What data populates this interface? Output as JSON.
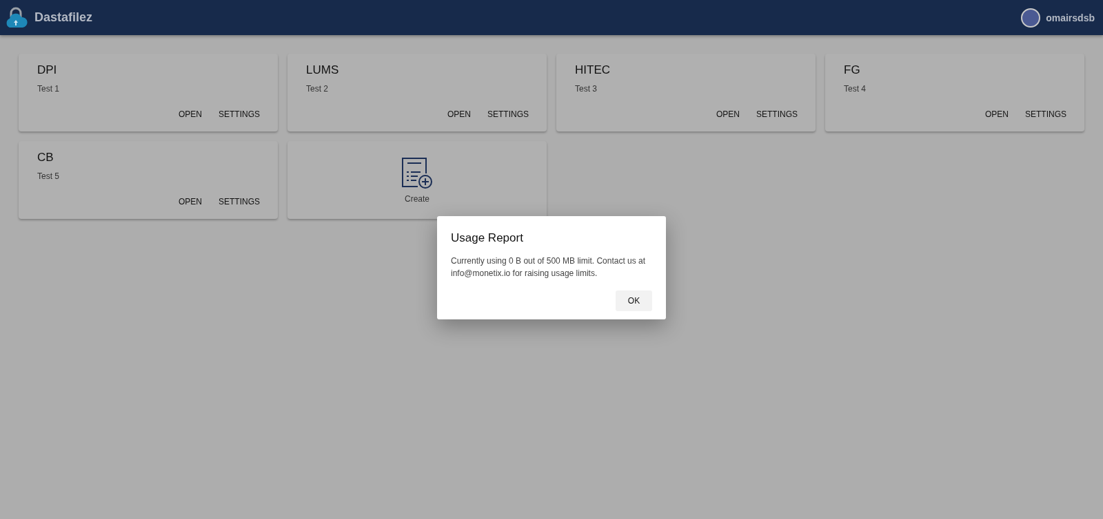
{
  "app_bar": {
    "title": "Dastafilez",
    "username": "omairsdsb"
  },
  "projects": [
    {
      "name": "DPI",
      "description": "Test 1",
      "actions": [
        "OPEN",
        "SETTINGS"
      ]
    },
    {
      "name": "LUMS",
      "description": "Test 2",
      "actions": [
        "OPEN",
        "SETTINGS"
      ]
    },
    {
      "name": "HITEC",
      "description": "Test 3",
      "actions": [
        "OPEN",
        "SETTINGS"
      ]
    },
    {
      "name": "FG",
      "description": "Test 4",
      "actions": [
        "OPEN",
        "SETTINGS"
      ]
    },
    {
      "name": "CB",
      "description": "Test 5",
      "actions": [
        "OPEN",
        "SETTINGS"
      ]
    }
  ],
  "create_card": {
    "label": "Create"
  },
  "dialog": {
    "title": "Usage Report",
    "message": "Currently using 0 B out of 500 MB limit. Contact us at info@monetix.io for raising usage limits.",
    "button": "OK"
  }
}
